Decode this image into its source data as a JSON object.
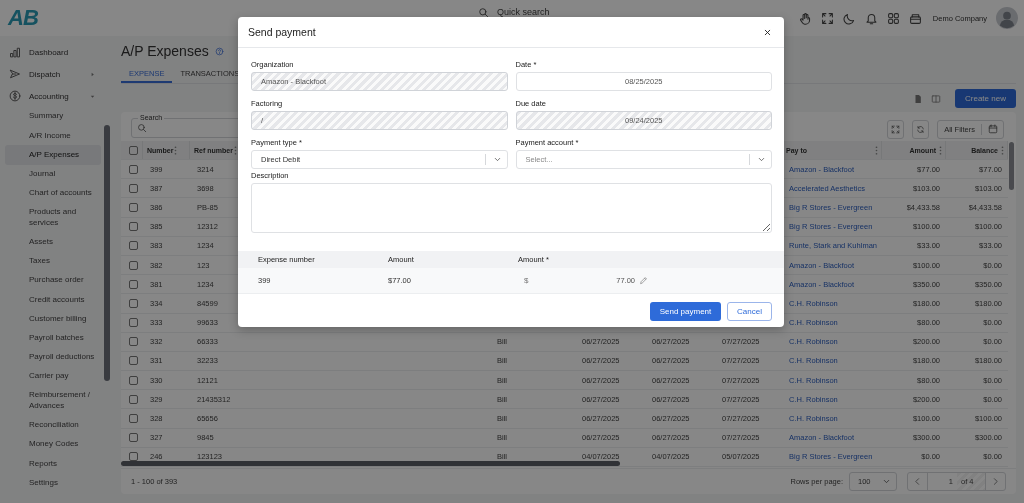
{
  "app": {
    "logo": "AB",
    "quick_search": {
      "placeholder": "Quick search"
    },
    "company": "Demo Company"
  },
  "sidebar": {
    "items": [
      {
        "label": "Dashboard",
        "kind": "link"
      },
      {
        "label": "Dispatch",
        "kind": "group",
        "expanded": false
      },
      {
        "label": "Accounting",
        "kind": "group",
        "expanded": true,
        "children": [
          {
            "label": "Summary",
            "selected": false
          },
          {
            "label": "A/R Income",
            "selected": false
          },
          {
            "label": "A/P Expenses",
            "selected": true
          },
          {
            "label": "Journal",
            "selected": false
          },
          {
            "label": "Chart of accounts",
            "selected": false
          },
          {
            "label": "Products and services",
            "selected": false
          },
          {
            "label": "Assets",
            "selected": false
          },
          {
            "label": "Taxes",
            "selected": false
          },
          {
            "label": "Purchase order",
            "selected": false
          },
          {
            "label": "Credit accounts",
            "selected": false
          },
          {
            "label": "Customer billing",
            "selected": false
          },
          {
            "label": "Payroll batches",
            "selected": false
          },
          {
            "label": "Payroll deductions",
            "selected": false
          },
          {
            "label": "Carrier pay",
            "selected": false
          },
          {
            "label": "Reimbursement / Advances",
            "selected": false
          },
          {
            "label": "Reconciliation",
            "selected": false
          },
          {
            "label": "Money Codes",
            "selected": false
          },
          {
            "label": "Reports",
            "selected": false
          },
          {
            "label": "Settings",
            "selected": false
          }
        ]
      }
    ]
  },
  "page": {
    "title": "A/P Expenses",
    "tabs": [
      {
        "label": "EXPENSE",
        "selected": true
      },
      {
        "label": "TRANSACTIONS",
        "selected": false
      }
    ],
    "create_button": "Create new"
  },
  "table": {
    "search": {
      "label": "Search"
    },
    "filters_button": "All Filters",
    "header_checkbox": {
      "checked": false
    },
    "columns": [
      {
        "label": "Number"
      },
      {
        "label": "Ref number"
      },
      {
        "label": "Pay to"
      },
      {
        "label": "Amount"
      },
      {
        "label": "Balance"
      }
    ],
    "rows": [
      {
        "checked": false,
        "number": "399",
        "ref": "3214",
        "pay_to": "Amazon - Blackfoot",
        "amount": "$77.00",
        "balance": "$77.00"
      },
      {
        "checked": false,
        "number": "387",
        "ref": "3698",
        "pay_to": "Accelerated Aesthetics",
        "amount": "$103.00",
        "balance": "$103.00"
      },
      {
        "checked": false,
        "number": "386",
        "ref": "PB-85",
        "pay_to": "Big R Stores - Evergreen",
        "amount": "$4,433.58",
        "balance": "$4,433.58"
      },
      {
        "checked": false,
        "number": "385",
        "ref": "12312",
        "pay_to": "Big R Stores - Evergreen",
        "amount": "$100.00",
        "balance": "$100.00"
      },
      {
        "checked": false,
        "number": "383",
        "ref": "1234",
        "pay_to": "Runte, Stark and Kuhlman",
        "amount": "$33.00",
        "balance": "$33.00"
      },
      {
        "checked": false,
        "number": "382",
        "ref": "123",
        "pay_to": "Amazon - Blackfoot",
        "amount": "$100.00",
        "balance": "$0.00"
      },
      {
        "checked": false,
        "number": "381",
        "ref": "1234",
        "pay_to": "Amazon - Blackfoot",
        "amount": "$350.00",
        "balance": "$350.00"
      },
      {
        "checked": false,
        "number": "334",
        "ref": "84599",
        "pay_to": "C.H. Robinson",
        "amount": "$180.00",
        "balance": "$180.00"
      },
      {
        "checked": false,
        "number": "333",
        "ref": "99633",
        "pay_to": "C.H. Robinson",
        "amount": "$80.00",
        "balance": "$0.00"
      },
      {
        "checked": false,
        "number": "332",
        "ref": "66333",
        "column_4": "Bill",
        "column_5": "06/27/2025",
        "column_6": "06/27/2025",
        "column_7": "07/27/2025",
        "pay_to": "C.H. Robinson",
        "amount": "$200.00",
        "balance": "$0.00"
      },
      {
        "checked": false,
        "number": "331",
        "ref": "32233",
        "column_4": "Bill",
        "column_5": "06/27/2025",
        "column_6": "06/27/2025",
        "column_7": "07/27/2025",
        "pay_to": "C.H. Robinson",
        "amount": "$180.00",
        "balance": "$180.00"
      },
      {
        "checked": false,
        "number": "330",
        "ref": "12121",
        "column_4": "Bill",
        "column_5": "06/27/2025",
        "column_6": "06/27/2025",
        "column_7": "07/27/2025",
        "pay_to": "C.H. Robinson",
        "amount": "$80.00",
        "balance": "$0.00"
      },
      {
        "checked": false,
        "number": "329",
        "ref": "21435312",
        "column_4": "Bill",
        "column_5": "06/27/2025",
        "column_6": "06/27/2025",
        "column_7": "07/27/2025",
        "pay_to": "C.H. Robinson",
        "amount": "$200.00",
        "balance": "$0.00"
      },
      {
        "checked": false,
        "number": "328",
        "ref": "65656",
        "column_4": "Bill",
        "column_5": "06/27/2025",
        "column_6": "06/27/2025",
        "column_7": "07/27/2025",
        "pay_to": "C.H. Robinson",
        "amount": "$100.00",
        "balance": "$100.00"
      },
      {
        "checked": false,
        "number": "327",
        "ref": "9845",
        "column_4": "Bill",
        "column_5": "06/27/2025",
        "column_6": "06/27/2025",
        "column_7": "07/27/2025",
        "pay_to": "Amazon - Blackfoot",
        "amount": "$300.00",
        "balance": "$300.00"
      },
      {
        "checked": false,
        "number": "246",
        "ref": "123123",
        "column_4": "Bill",
        "column_5": "04/07/2025",
        "column_6": "04/07/2025",
        "column_7": "05/07/2025",
        "pay_to": "Big R Stores - Evergreen",
        "amount": "$0.00",
        "balance": "$0.00"
      }
    ],
    "footer": {
      "range": "1 - 100 of 393",
      "rows_per_page_label": "Rows per page:",
      "rows_per_page": "100",
      "page": "1",
      "page_count": "of 4"
    }
  },
  "modal": {
    "title": "Send payment",
    "fields": [
      {
        "label": "Organization",
        "kind": "text",
        "disabled": true,
        "value": "Amazon - Blackfoot"
      },
      {
        "label": "Date *",
        "kind": "date",
        "disabled": false,
        "value": "08/25/2025"
      },
      {
        "label": "Factoring",
        "kind": "text",
        "disabled": true,
        "value": "/"
      },
      {
        "label": "Due date",
        "kind": "date",
        "disabled": true,
        "value": "09/24/2025"
      },
      {
        "label": "Payment type *",
        "kind": "select",
        "disabled": false,
        "value": "Direct Debit"
      },
      {
        "label": "Payment account *",
        "kind": "select",
        "disabled": false,
        "placeholder": "Select..."
      },
      {
        "label": "Description",
        "kind": "textarea",
        "disabled": false
      }
    ],
    "lines": {
      "columns": [
        "Expense number",
        "Amount",
        "Amount *"
      ],
      "rows": [
        {
          "expense_number": "399",
          "amount": "$77.00",
          "currency": "$",
          "payment": "77.00"
        }
      ]
    },
    "buttons": [
      {
        "label": "Send payment",
        "kind": "primary"
      },
      {
        "label": "Cancel",
        "kind": "secondary"
      }
    ]
  }
}
